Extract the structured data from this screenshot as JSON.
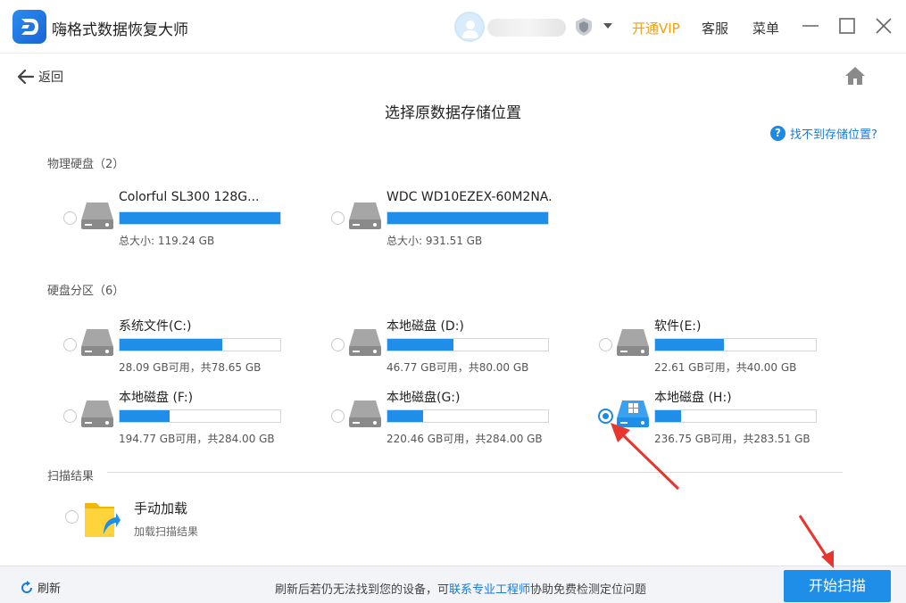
{
  "app": {
    "title": "嗨格式数据恢复大师",
    "open_vip": "开通VIP",
    "service": "客服",
    "menu": "菜单",
    "colors": {
      "accent": "#1f8ee9",
      "vip": "#f0a015",
      "annotation": "#e8352e"
    }
  },
  "nav": {
    "back_label": "返回",
    "home_icon": "home-icon"
  },
  "page": {
    "title": "选择原数据存储位置",
    "help_link": "找不到存储位置?"
  },
  "physical": {
    "label": "物理硬盘（2）",
    "disks": [
      {
        "name": "Colorful SL300 128G...",
        "info": "总大小: 119.24 GB",
        "used_fraction": 1.0,
        "selected": false
      },
      {
        "name": "WDC WD10EZEX-60M2NA.",
        "info": "总大小: 931.51 GB",
        "used_fraction": 1.0,
        "selected": false
      }
    ]
  },
  "partitions": {
    "label": "硬盘分区（6）",
    "disks": [
      {
        "name": "系统文件(C:)",
        "info": "28.09 GB可用，共78.65 GB",
        "used_fraction": 0.64,
        "selected": false
      },
      {
        "name": "本地磁盘 (D:)",
        "info": "46.77 GB可用，共80.00 GB",
        "used_fraction": 0.41,
        "selected": false
      },
      {
        "name": "软件(E:)",
        "info": "22.61 GB可用，共40.00 GB",
        "used_fraction": 0.43,
        "selected": false
      },
      {
        "name": "本地磁盘 (F:)",
        "info": "194.77 GB可用，共284.00 GB",
        "used_fraction": 0.31,
        "selected": false
      },
      {
        "name": "本地磁盘(G:)",
        "info": "220.46 GB可用，共284.00 GB",
        "used_fraction": 0.22,
        "selected": false
      },
      {
        "name": "本地磁盘 (H:)",
        "info": "236.75 GB可用，共283.51 GB",
        "used_fraction": 0.16,
        "selected": true
      }
    ]
  },
  "scan_results": {
    "label": "扫描结果",
    "manual_title": "手动加载",
    "manual_sub": "加载扫描结果"
  },
  "footer": {
    "refresh_label": "刷新",
    "note_prefix": "刷新后若仍无法找到您的设备，可",
    "note_link": "联系专业工程师",
    "note_suffix": "协助免费检测定位问题",
    "start_button": "开始扫描"
  }
}
